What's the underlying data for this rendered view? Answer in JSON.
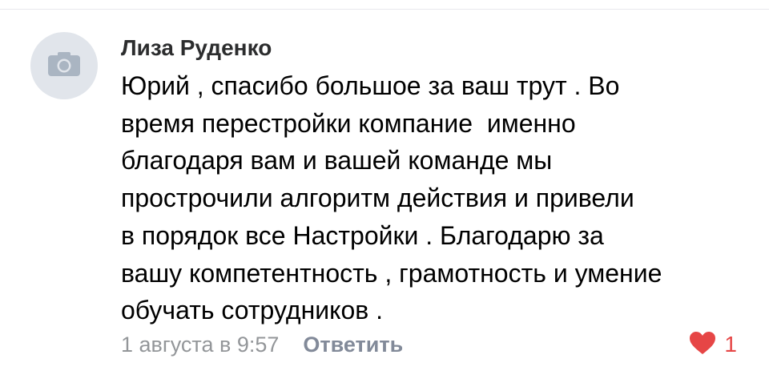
{
  "comment": {
    "author": "Лиза Руденко",
    "avatar_icon": "camera-icon",
    "lines": [
      "Юрий , спасибо большое за ваш трут . Во",
      "время перестройки компание  именно",
      "благодаря вам и вашей команде мы",
      "прострочили алгоритм действия и привели",
      "в порядок все Настройки . Благодарю за",
      "вашу компетентность , грамотность и умение",
      "обучать сотрудников ."
    ],
    "timestamp": "1 августа в 9:57",
    "reply_label": "Ответить",
    "like_icon": "heart-icon",
    "like_count": "1"
  },
  "colors": {
    "like": "#e64646",
    "meta": "#939699",
    "avatar_bg": "#e1e5eb"
  }
}
